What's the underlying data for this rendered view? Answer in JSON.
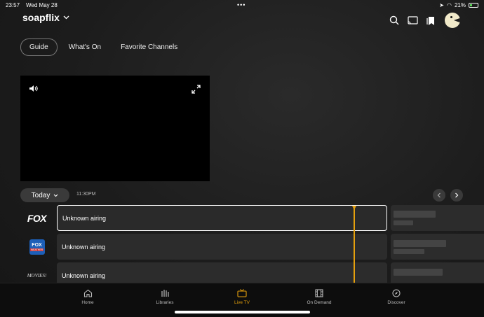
{
  "status": {
    "time": "23:57",
    "date": "Wed May 28",
    "battery": "21%"
  },
  "brand": {
    "name": "soapflix"
  },
  "tabs": [
    {
      "label": "Guide",
      "active": true
    },
    {
      "label": "What's On",
      "active": false
    },
    {
      "label": "Favorite Channels",
      "active": false
    }
  ],
  "guide": {
    "day": "Today",
    "timeslot": "11:30PM",
    "channels": [
      {
        "logo": "FOX",
        "program": "Unknown airing",
        "selected": true
      },
      {
        "logo": "FOX WEATHER",
        "logo_top": "FOX",
        "logo_bottom": "WEATHER",
        "program": "Unknown airing",
        "selected": false
      },
      {
        "logo": "MOVIES!",
        "program": "Unknown airing",
        "selected": false
      }
    ]
  },
  "bottom_nav": [
    {
      "label": "Home",
      "icon": "home-icon",
      "active": false
    },
    {
      "label": "Libraries",
      "icon": "libraries-icon",
      "active": false
    },
    {
      "label": "Live TV",
      "icon": "tv-icon",
      "active": true
    },
    {
      "label": "On Demand",
      "icon": "film-icon",
      "active": false
    },
    {
      "label": "Discover",
      "icon": "compass-icon",
      "active": false
    }
  ],
  "colors": {
    "accent": "#e5a00d",
    "background": "#1c1c1c"
  }
}
